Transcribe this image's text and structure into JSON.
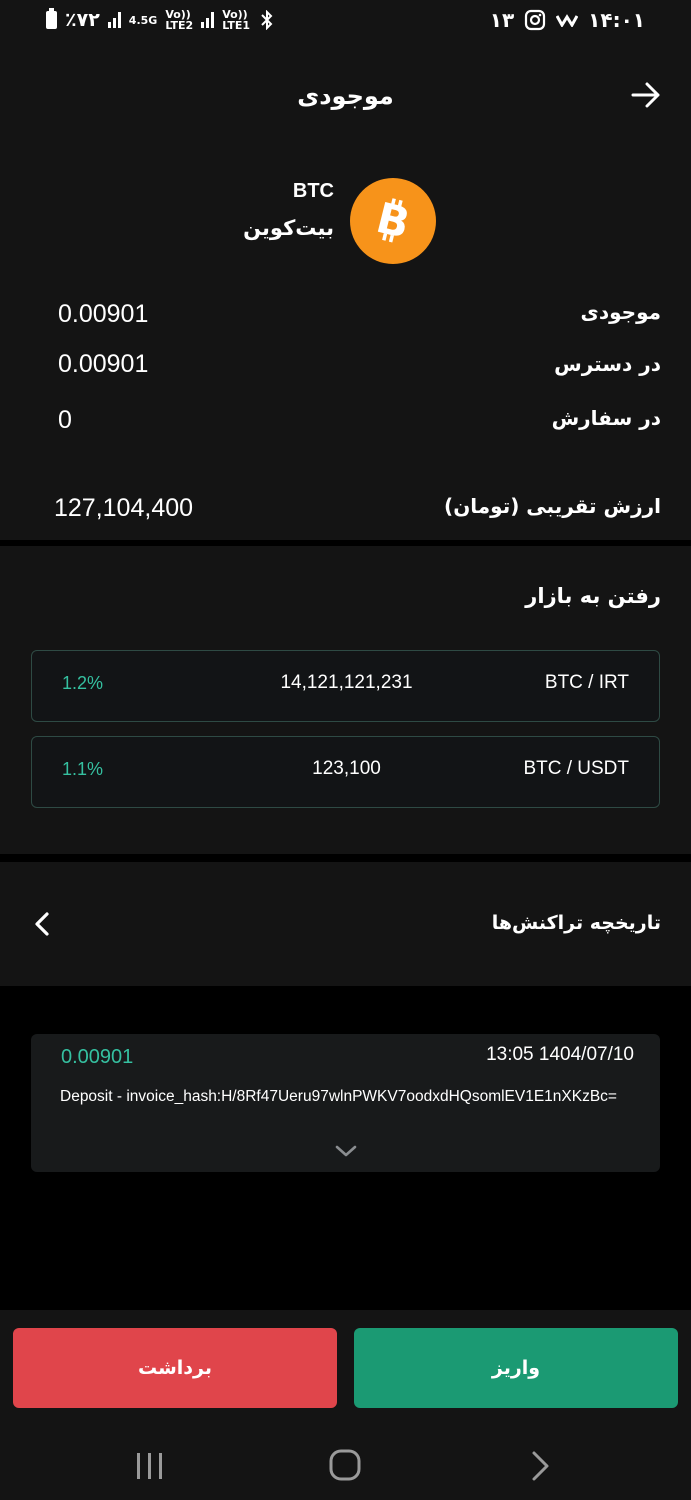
{
  "status_bar": {
    "battery": "٪۷۲",
    "network1": "4.5G",
    "network2_top": "Vo))",
    "network2_bottom": "LTE2",
    "network3_top": "Vo))",
    "network3_bottom": "LTE1",
    "notification_count": "۱۳",
    "time": "۱۴:۰۱"
  },
  "header": {
    "title": "موجودی"
  },
  "coin": {
    "symbol": "BTC",
    "name": "بیت‌کوین",
    "logo_color": "#f7931a"
  },
  "balances": [
    {
      "label": "موجودی",
      "value": "0.00901"
    },
    {
      "label": "در دسترس",
      "value": "0.00901"
    },
    {
      "label": "در سفارش",
      "value": "0"
    }
  ],
  "estimated_value": {
    "label": "ارزش تقریبی (تومان)",
    "value": "127,104,400"
  },
  "market": {
    "title": "رفتن به بازار",
    "pairs": [
      {
        "pair": "BTC / IRT",
        "price": "14,121,121,231",
        "change": "1.2%"
      },
      {
        "pair": "BTC / USDT",
        "price": "123,100",
        "change": "1.1%"
      }
    ]
  },
  "history": {
    "title": "تاریخچه تراکنش‌ها"
  },
  "transaction": {
    "amount": "0.00901",
    "datetime": "13:05 1404/07/10",
    "description": "Deposit - invoice_hash:H/8Rf47Ueru97wlnPWKV7oodxdHQsomlEV1E1nXKzBc="
  },
  "actions": {
    "withdraw_label": "برداشت",
    "deposit_label": "واریز"
  },
  "colors": {
    "accent_green": "#1b9a73",
    "accent_red": "#e0454b",
    "positive_text": "#35c0a0"
  }
}
